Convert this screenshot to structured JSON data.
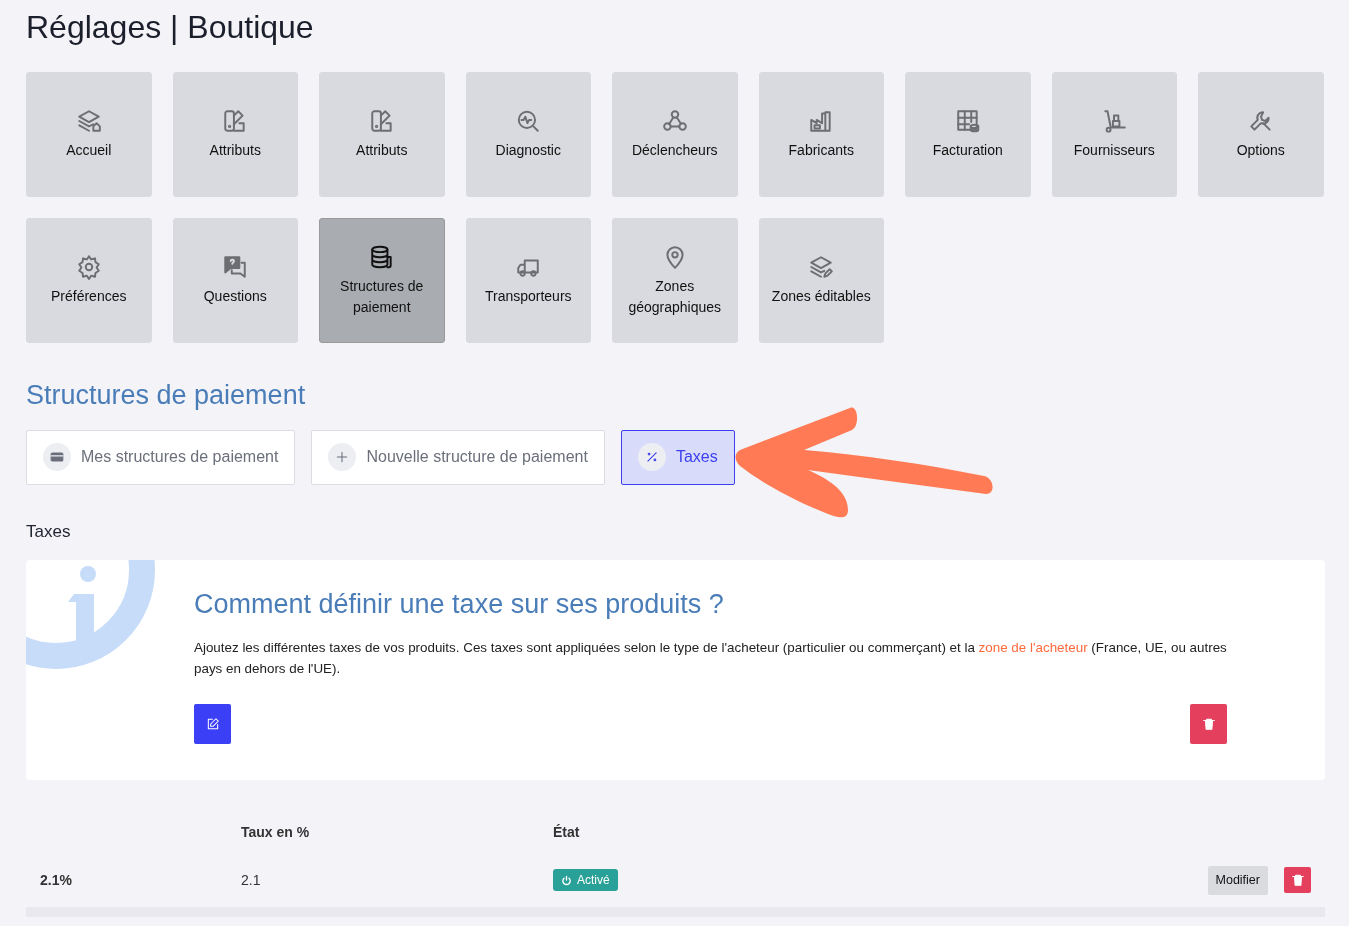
{
  "page_title": "Réglages | Boutique",
  "tiles": [
    {
      "label": "Accueil",
      "kind": "layers",
      "selected": false
    },
    {
      "label": "Attributs",
      "kind": "swatch",
      "selected": false
    },
    {
      "label": "Attributs",
      "kind": "swatch",
      "selected": false
    },
    {
      "label": "Diagnostic",
      "kind": "diagnostic",
      "selected": false
    },
    {
      "label": "Déclencheurs",
      "kind": "webhook",
      "selected": false
    },
    {
      "label": "Fabricants",
      "kind": "factory",
      "selected": false
    },
    {
      "label": "Facturation",
      "kind": "grid",
      "selected": false
    },
    {
      "label": "Fournisseurs",
      "kind": "dolly",
      "selected": false
    },
    {
      "label": "Options",
      "kind": "wrench",
      "selected": false
    },
    {
      "label": "Préférences",
      "kind": "gear",
      "selected": false
    },
    {
      "label": "Questions",
      "kind": "chat",
      "selected": false
    },
    {
      "label": "Structures de paiement",
      "kind": "coins",
      "selected": true
    },
    {
      "label": "Transporteurs",
      "kind": "truck",
      "selected": false
    },
    {
      "label": "Zones géographiques",
      "kind": "pin",
      "selected": false
    },
    {
      "label": "Zones éditables",
      "kind": "layersedit",
      "selected": false
    }
  ],
  "section_title": "Structures de paiement",
  "tabs": [
    {
      "label": "Mes structures de paiement",
      "kind": "card",
      "selected": false
    },
    {
      "label": "Nouvelle structure de paiement",
      "kind": "plus",
      "selected": false
    },
    {
      "label": "Taxes",
      "kind": "percent",
      "selected": true
    }
  ],
  "subsection_title": "Taxes",
  "info": {
    "title": "Comment définir une taxe sur ses produits ?",
    "text_before": "Ajoutez les différentes taxes de vos produits. Ces taxes sont appliquées selon le type de l'acheteur (particulier ou commerçant) et la ",
    "link": "zone de l'acheteur",
    "text_after": " (France, UE, ou autres pays en dehors de l'UE)."
  },
  "table": {
    "headers": {
      "rate": "Taux en %",
      "state": "État"
    },
    "rows": [
      {
        "name": "2.1%",
        "rate": "2.1",
        "status": "Activé",
        "active": true,
        "edit_label": "Modifier"
      }
    ]
  }
}
